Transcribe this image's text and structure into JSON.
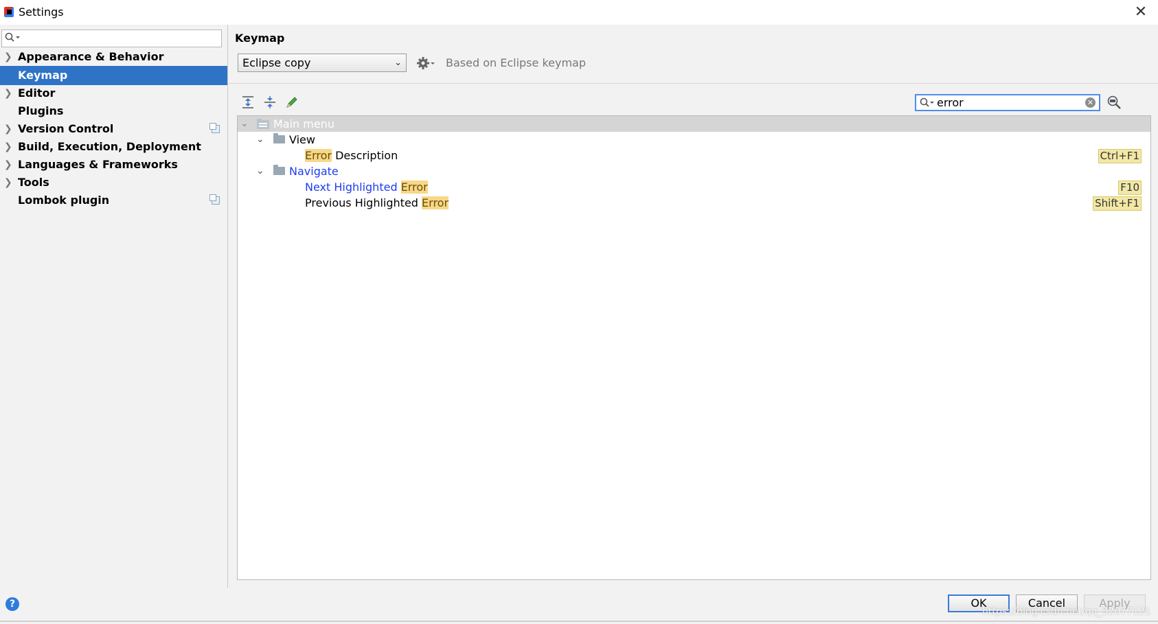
{
  "window": {
    "title": "Settings",
    "close_label": "✕"
  },
  "sidebar": {
    "search_placeholder": "",
    "items": [
      {
        "label": "Appearance & Behavior",
        "expandable": true,
        "selected": false
      },
      {
        "label": "Keymap",
        "expandable": false,
        "selected": true
      },
      {
        "label": "Editor",
        "expandable": true,
        "selected": false
      },
      {
        "label": "Plugins",
        "expandable": false,
        "selected": false
      },
      {
        "label": "Version Control",
        "expandable": true,
        "selected": false,
        "project_icon": true
      },
      {
        "label": "Build, Execution, Deployment",
        "expandable": true,
        "selected": false
      },
      {
        "label": "Languages & Frameworks",
        "expandable": true,
        "selected": false
      },
      {
        "label": "Tools",
        "expandable": true,
        "selected": false
      },
      {
        "label": "Lombok plugin",
        "expandable": false,
        "selected": false,
        "project_icon": true
      }
    ]
  },
  "main": {
    "section_title": "Keymap",
    "keymap_select": "Eclipse copy",
    "based_on": "Based on Eclipse keymap",
    "filter_value": "error",
    "tree": {
      "root": "Main menu",
      "view_group": "View",
      "view_item_highlight": "Error",
      "view_item_rest": " Description",
      "view_item_shortcut": "Ctrl+F1",
      "navigate_group": "Navigate",
      "nav_item1_rest": "Next Highlighted ",
      "nav_item1_highlight": "Error",
      "nav_item1_shortcut": "F10",
      "nav_item2_rest": "Previous Highlighted ",
      "nav_item2_highlight": "Error",
      "nav_item2_shortcut": "Shift+F1"
    }
  },
  "buttons": {
    "help": "?",
    "ok": "OK",
    "cancel": "Cancel",
    "apply": "Apply"
  },
  "watermark": "https://blog.csdn.net/qq_32077121",
  "colors": {
    "selection": "#2f73c7",
    "highlight": "#f7d78a",
    "link_blue": "#1f3cf0",
    "focus_border": "#4d8ee8"
  }
}
